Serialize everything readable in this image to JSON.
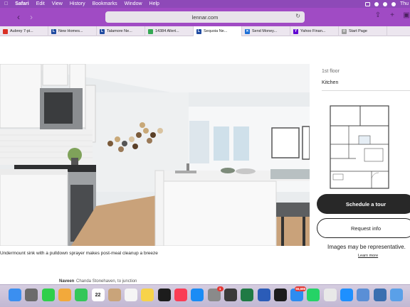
{
  "menubar": {
    "apple_icon": "apple-icon",
    "menus": [
      "Safari",
      "Edit",
      "View",
      "History",
      "Bookmarks",
      "Window",
      "Help"
    ],
    "clock": "Thu"
  },
  "toolbar": {
    "address": "lennar.com"
  },
  "tabs": [
    {
      "label": "Aubrey 7-pi...",
      "color": "#d93025",
      "glyph": ""
    },
    {
      "label": "New Homes...",
      "color": "#1f4aa0",
      "glyph": "L"
    },
    {
      "label": "Talamore Ne...",
      "color": "#1f4aa0",
      "glyph": "L"
    },
    {
      "label": "14384 Allert...",
      "color": "#34a853",
      "glyph": ""
    },
    {
      "label": "Sequoia Ne...",
      "color": "#1f4aa0",
      "glyph": "L"
    },
    {
      "label": "Send Money...",
      "color": "#1d6fd6",
      "glyph": "✕"
    },
    {
      "label": "Yahoo Finan...",
      "color": "#6001d2",
      "glyph": "Y"
    },
    {
      "label": "Start Page",
      "color": "#9b9b9b",
      "glyph": "☆"
    }
  ],
  "gallery": {
    "caption": "Undermount sink with a pulldown sprayer makes post-meal cleanup a breeze"
  },
  "plan": {
    "floor": "1st floor",
    "room": "Kitchen"
  },
  "actions": {
    "tour_label": "Schedule a tour",
    "info_label": "Request info"
  },
  "disclaimer": {
    "text": "Images may be representative.",
    "link": "Learn more"
  },
  "notification": {
    "sender": "Naveen",
    "message": "Chanda Stonehaven, to junction"
  },
  "dock": {
    "calendar_day": "22",
    "mail_badge": "55,686",
    "settings_badge": "1",
    "apps": [
      {
        "name": "finder-icon",
        "color": "#3b8ff0"
      },
      {
        "name": "launchpad-icon",
        "color": "#6b6b6b"
      },
      {
        "name": "messages-icon",
        "color": "#2fcf4b"
      },
      {
        "name": "photos-icon",
        "color": "#f2a93b"
      },
      {
        "name": "facetime-icon",
        "color": "#34c759"
      },
      {
        "name": "calendar-icon",
        "color": "#ffffff"
      },
      {
        "name": "contacts-icon",
        "color": "#c9a47a"
      },
      {
        "name": "reminders-icon",
        "color": "#f5f5f5"
      },
      {
        "name": "notes-icon",
        "color": "#f7d34a"
      },
      {
        "name": "apple-tv-icon",
        "color": "#1c1c1c"
      },
      {
        "name": "music-icon",
        "color": "#fa3c55"
      },
      {
        "name": "app-store-icon",
        "color": "#1a8cf5"
      },
      {
        "name": "system-settings-icon",
        "color": "#8a8a8a"
      },
      {
        "name": "calculator-icon",
        "color": "#3a3a3a"
      },
      {
        "name": "excel-icon",
        "color": "#1f7a44"
      },
      {
        "name": "word-icon",
        "color": "#2b5cb8"
      },
      {
        "name": "stocks-icon",
        "color": "#1c1c1c"
      },
      {
        "name": "mail-icon",
        "color": "#2d8cf0"
      },
      {
        "name": "whatsapp-icon",
        "color": "#25d366"
      },
      {
        "name": "chrome-icon",
        "color": "#e8e8e8"
      },
      {
        "name": "safari-icon",
        "color": "#1e90ff"
      },
      {
        "name": "preview-icon",
        "color": "#5a8fd6"
      },
      {
        "name": "quicktime-icon",
        "color": "#3a6fb0"
      },
      {
        "name": "downloads-icon",
        "color": "#5aa0e8"
      }
    ]
  },
  "colors": {
    "accent_purple": "#a04bc4",
    "button_dark": "#282828"
  }
}
